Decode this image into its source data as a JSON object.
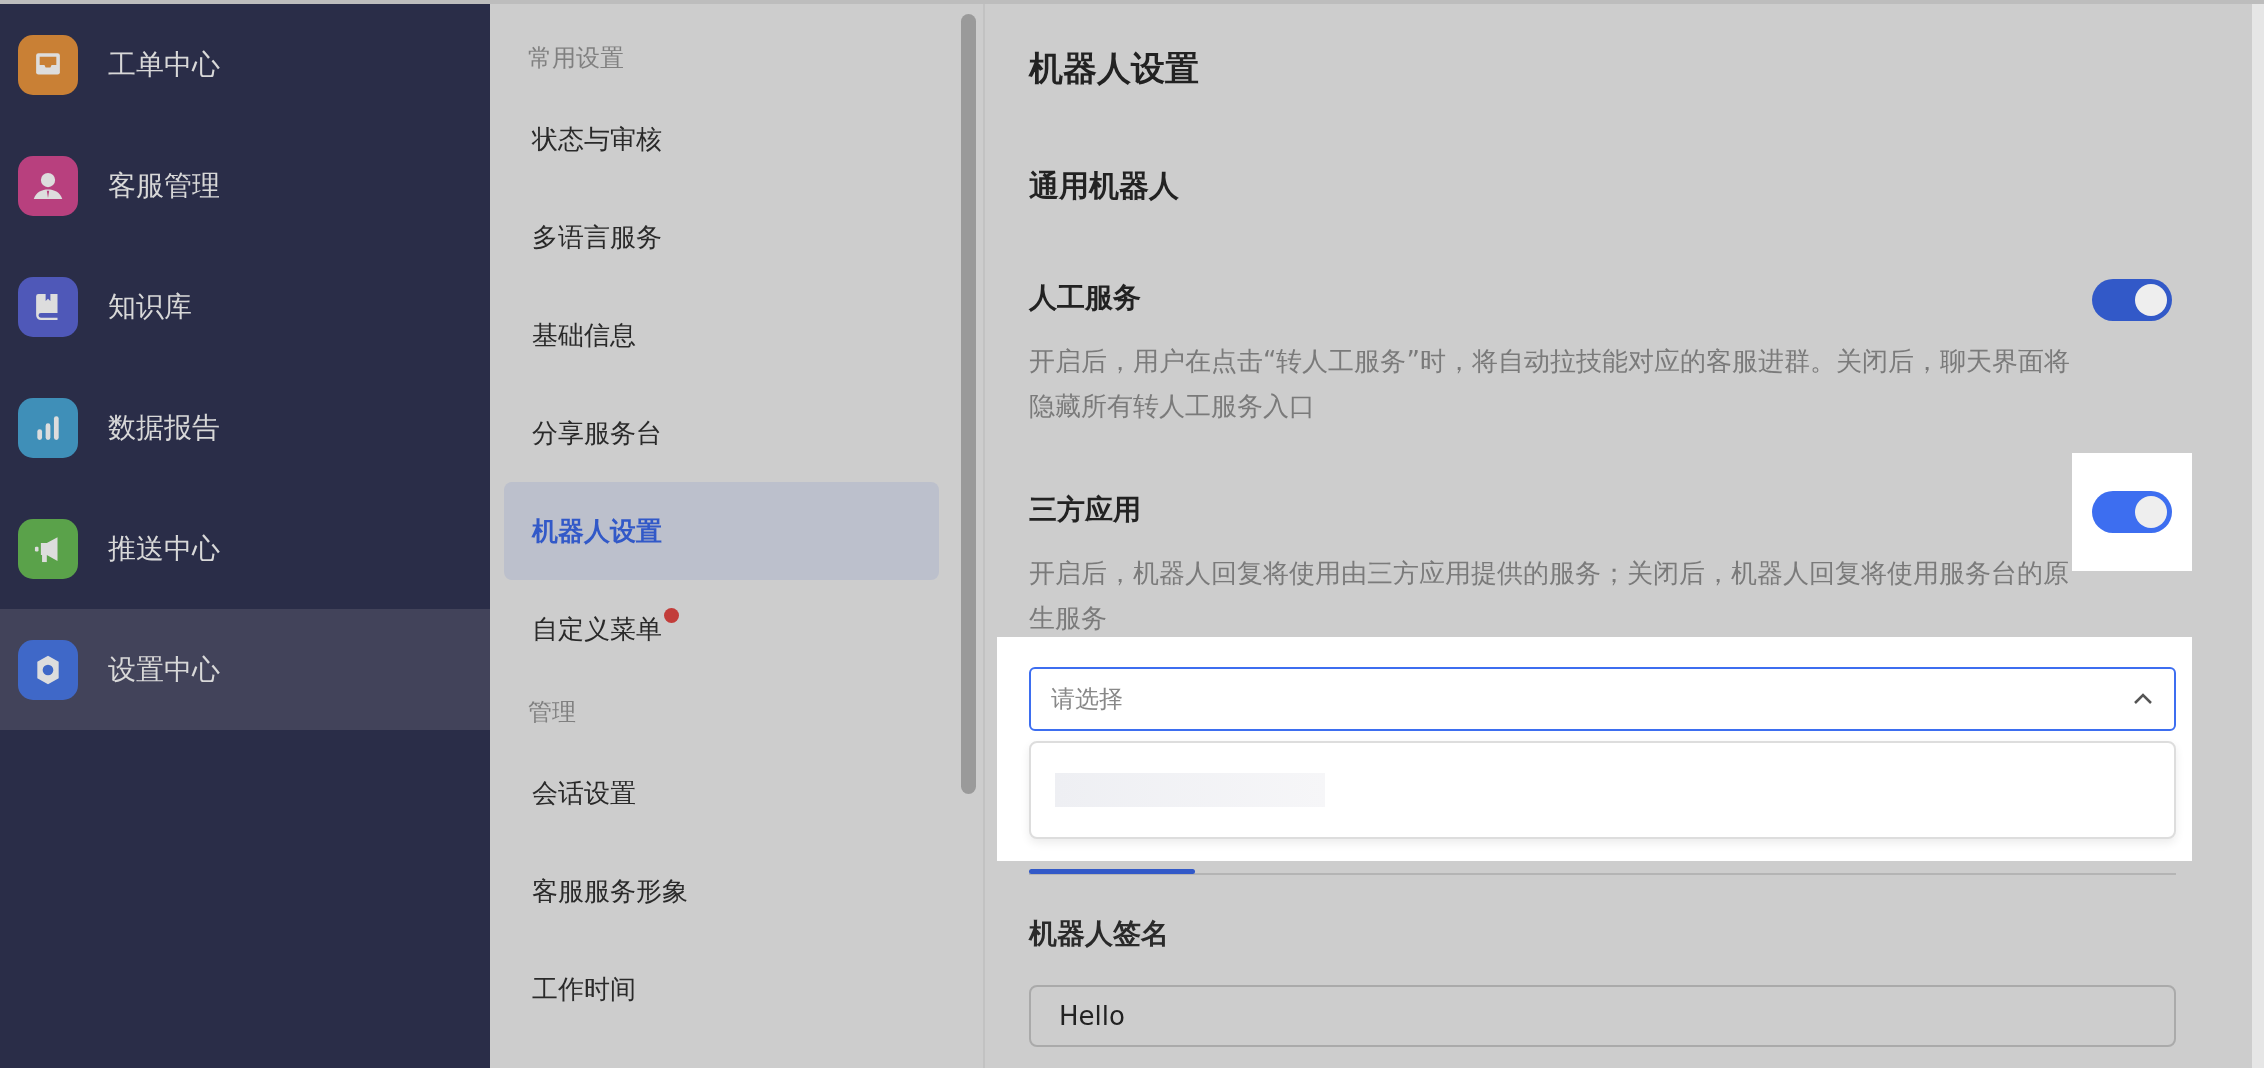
{
  "sidebar": {
    "items": [
      {
        "label": "工单中心",
        "kind": "inbox",
        "color": "#c98035",
        "selected": false
      },
      {
        "label": "客服管理",
        "kind": "agent",
        "color": "#b8407e",
        "selected": false
      },
      {
        "label": "知识库",
        "kind": "book",
        "color": "#4f58b8",
        "selected": false
      },
      {
        "label": "数据报告",
        "kind": "chart",
        "color": "#3f8fb8",
        "selected": false
      },
      {
        "label": "推送中心",
        "kind": "megaphone",
        "color": "#5aa24a",
        "selected": false
      },
      {
        "label": "设置中心",
        "kind": "gear",
        "color": "#3f68c8",
        "selected": true
      }
    ]
  },
  "menu": {
    "groups": [
      {
        "title": "常用设置",
        "items": [
          {
            "label": "状态与审核",
            "selected": false,
            "dot": false
          },
          {
            "label": "多语言服务",
            "selected": false,
            "dot": false
          },
          {
            "label": "基础信息",
            "selected": false,
            "dot": false
          },
          {
            "label": "分享服务台",
            "selected": false,
            "dot": false
          },
          {
            "label": "机器人设置",
            "selected": true,
            "dot": false
          },
          {
            "label": "自定义菜单",
            "selected": false,
            "dot": true
          }
        ]
      },
      {
        "title": "管理",
        "items": [
          {
            "label": "会话设置",
            "selected": false,
            "dot": false
          },
          {
            "label": "客服服务形象",
            "selected": false,
            "dot": false
          },
          {
            "label": "工作时间",
            "selected": false,
            "dot": false
          }
        ]
      }
    ]
  },
  "page_title": "机器人设置",
  "section_title": "通用机器人",
  "settings": [
    {
      "title": "人工服务",
      "description": "开启后，用户在点击“转人工服务”时，将自动拉技能对应的客服进群。关闭后，聊天界面将隐藏所有转人工服务入口",
      "on": true,
      "highlighted": false
    },
    {
      "title": "三方应用",
      "description": "开启后，机器人回复将使用由三方应用提供的服务；关闭后，机器人回复将使用服务台的原生服务",
      "on": true,
      "highlighted": true
    }
  ],
  "select": {
    "placeholder": "请选择",
    "expanded": true
  },
  "signature": {
    "label": "机器人签名",
    "value": "Hello"
  }
}
